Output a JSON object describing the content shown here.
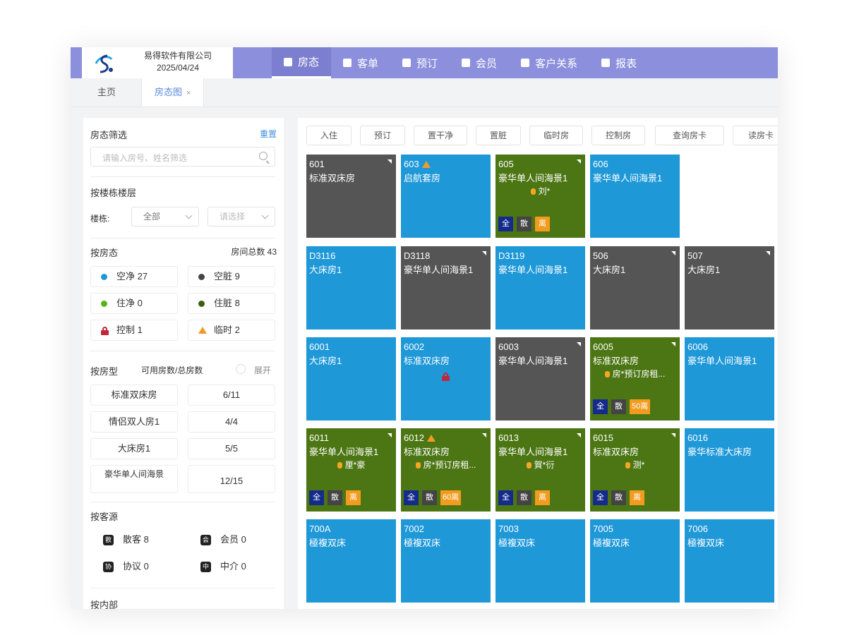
{
  "header": {
    "company": "易得软件有限公司",
    "date": "2025/04/24",
    "nav": [
      {
        "label": "房态",
        "icon": "room-status-icon",
        "active": true
      },
      {
        "label": "客单",
        "icon": "order-icon",
        "active": false
      },
      {
        "label": "预订",
        "icon": "booking-icon",
        "active": false
      },
      {
        "label": "会员",
        "icon": "member-icon",
        "active": false
      },
      {
        "label": "客户关系",
        "icon": "crm-icon",
        "active": false
      },
      {
        "label": "报表",
        "icon": "report-icon",
        "active": false
      }
    ]
  },
  "tabs": [
    {
      "label": "主页"
    },
    {
      "label": "房态图",
      "close": "×"
    }
  ],
  "sidebar": {
    "filter_title": "房态筛选",
    "reset_label": "重置",
    "search_placeholder": "请输入房号、姓名筛选",
    "building_section": "按楼栋楼层",
    "building_label": "楼栋:",
    "building_value": "全部",
    "floor_placeholder": "请选择",
    "status_section": "按房态",
    "room_total": "房间总数 43",
    "statuses": [
      {
        "label": "空净 27",
        "color": "#1f98d8",
        "shape": "dot"
      },
      {
        "label": "空脏 9",
        "color": "#444444",
        "shape": "dot"
      },
      {
        "label": "住净 0",
        "color": "#59b41a",
        "shape": "dot"
      },
      {
        "label": "住脏 8",
        "color": "#3c5e12",
        "shape": "dot"
      },
      {
        "label": "控制 1",
        "color": "#c0283a",
        "shape": "lock"
      },
      {
        "label": "临时 2",
        "color": "#f19a2a",
        "shape": "triangle"
      }
    ],
    "type_section": "按房型",
    "type_header": "可用房数/总房数",
    "expand_label": "展开",
    "room_types": [
      {
        "name": "标准双床房",
        "count": "6/11"
      },
      {
        "name": "情侣双人房1",
        "count": "4/4"
      },
      {
        "name": "大床房1",
        "count": "5/5"
      },
      {
        "name": "豪华单人间海景",
        "count": "12/15"
      }
    ],
    "channel_section": "按客源",
    "channels": [
      {
        "icon": "散",
        "label": "散客 8"
      },
      {
        "icon": "会",
        "label": "会员 0"
      },
      {
        "icon": "协",
        "label": "协议 0"
      },
      {
        "icon": "中",
        "label": "中介 0"
      }
    ],
    "bottom_section": "按内部"
  },
  "toolbar": [
    "入住",
    "预订",
    "置干净",
    "置脏",
    "临时房",
    "控制房",
    "查询房卡",
    "读房卡"
  ],
  "colors": {
    "vacant_clean": "#1f98d8",
    "vacant_dirty": "#555555",
    "occupied_dirty": "#4c7614",
    "accent": "#8c8fdc"
  },
  "rooms": [
    [
      {
        "no": "601",
        "type": "标准双床房",
        "state": "dark",
        "corner": true
      },
      {
        "no": "603",
        "type": "启航套房",
        "state": "blue",
        "warn": true
      },
      {
        "no": "605",
        "type": "豪华单人间海景1",
        "state": "green",
        "corner": true,
        "guest": "刘*",
        "badges": [
          "全",
          "散",
          "离"
        ]
      },
      {
        "no": "606",
        "type": "豪华单人间海景1",
        "state": "blue"
      }
    ],
    [
      {
        "no": "D3116",
        "type": "大床房1",
        "state": "blue"
      },
      {
        "no": "D3118",
        "type": "豪华单人间海景1",
        "state": "dark",
        "corner": true
      },
      {
        "no": "D3119",
        "type": "豪华单人间海景1",
        "state": "blue"
      },
      {
        "no": "506",
        "type": "大床房1",
        "state": "dark",
        "corner": true
      },
      {
        "no": "507",
        "type": "大床房1",
        "state": "dark",
        "corner": true
      }
    ],
    [
      {
        "no": "6001",
        "type": "大床房1",
        "state": "blue"
      },
      {
        "no": "6002",
        "type": "标准双床房",
        "state": "blue",
        "lock": true
      },
      {
        "no": "6003",
        "type": "豪华单人间海景1",
        "state": "dark",
        "corner": true
      },
      {
        "no": "6005",
        "type": "标准双床房",
        "state": "green",
        "corner": true,
        "guest": "房*预订房租...",
        "badges": [
          "全",
          "散",
          "50离"
        ]
      },
      {
        "no": "6006",
        "type": "豪华单人间海景1",
        "state": "blue"
      }
    ],
    [
      {
        "no": "6011",
        "type": "豪华单人间海景1",
        "state": "green",
        "corner": true,
        "guest": "厘*豪",
        "badges": [
          "全",
          "散",
          "离"
        ]
      },
      {
        "no": "6012",
        "type": "标准双床房",
        "state": "green",
        "corner": true,
        "warn": true,
        "guest": "房*预订房租...",
        "badges": [
          "全",
          "散",
          "60离"
        ]
      },
      {
        "no": "6013",
        "type": "豪华单人间海景1",
        "state": "green",
        "corner": true,
        "guest": "賀*衍",
        "badges": [
          "全",
          "散",
          "离"
        ]
      },
      {
        "no": "6015",
        "type": "标准双床房",
        "state": "green",
        "corner": true,
        "guest": "测*",
        "badges": [
          "全",
          "散",
          "离"
        ]
      },
      {
        "no": "6016",
        "type": "豪华标准大床房",
        "state": "blue"
      }
    ],
    [
      {
        "no": "700A",
        "type": "極複双床",
        "state": "blue"
      },
      {
        "no": "7002",
        "type": "極複双床",
        "state": "blue"
      },
      {
        "no": "7003",
        "type": "極複双床",
        "state": "blue"
      },
      {
        "no": "7005",
        "type": "極複双床",
        "state": "blue"
      },
      {
        "no": "7006",
        "type": "極複双床",
        "state": "blue"
      }
    ]
  ]
}
